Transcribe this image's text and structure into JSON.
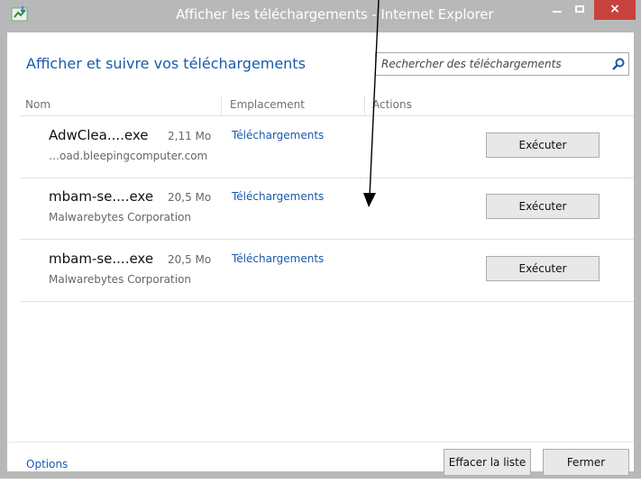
{
  "window": {
    "title": "Afficher les téléchargements - Internet Explorer",
    "close_glyph": "×"
  },
  "header": {
    "title": "Afficher et suivre vos téléchargements",
    "search_placeholder": "Rechercher des téléchargements"
  },
  "columns": [
    "Nom",
    "Emplacement",
    "Actions"
  ],
  "downloads": [
    {
      "name": "AdwClea....exe",
      "size": "2,11 Mo",
      "source": "…oad.bleepingcomputer.com",
      "location": "Téléchargements",
      "action": "Exécuter"
    },
    {
      "name": "mbam-se....exe",
      "size": "20,5 Mo",
      "source": "Malwarebytes Corporation",
      "location": "Téléchargements",
      "action": "Exécuter"
    },
    {
      "name": "mbam-se....exe",
      "size": "20,5 Mo",
      "source": "Malwarebytes Corporation",
      "location": "Téléchargements",
      "action": "Exécuter"
    }
  ],
  "footer": {
    "options": "Options",
    "clear": "Effacer la liste",
    "close": "Fermer"
  },
  "colors": {
    "accent": "#1a5aad",
    "titlebar": "#b8b8b8",
    "close_button": "#c7423c"
  },
  "icons": [
    "ie-download-icon",
    "minimize-icon",
    "maximize-icon",
    "close-icon",
    "search-icon"
  ]
}
